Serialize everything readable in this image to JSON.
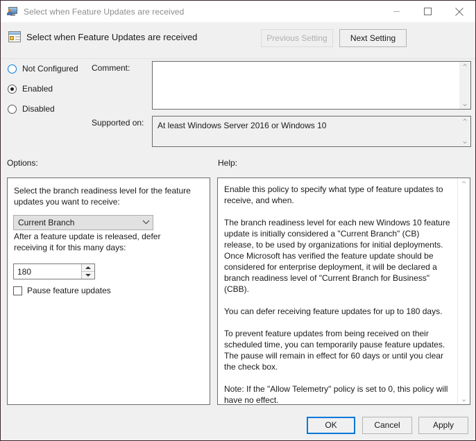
{
  "window": {
    "title": "Select when Feature Updates are received",
    "icon": "policy-monitor-icon",
    "minimize_label": "—",
    "maximize_label": "☐",
    "close_label": "✕"
  },
  "header": {
    "icon": "policy-setting-icon",
    "title": "Select when Feature Updates are received",
    "previous_setting_label": "Previous Setting",
    "next_setting_label": "Next Setting"
  },
  "state": {
    "radios": [
      {
        "label": "Not Configured",
        "selected": false
      },
      {
        "label": "Enabled",
        "selected": true
      },
      {
        "label": "Disabled",
        "selected": false
      }
    ],
    "comment_label": "Comment:",
    "comment_value": "",
    "supported_on_label": "Supported on:",
    "supported_on_value": "At least Windows Server 2016 or Windows 10"
  },
  "options": {
    "section_label": "Options:",
    "branch_prompt": "Select the branch readiness level for the feature updates you want to receive:",
    "branch_selected": "Current Branch",
    "defer_prompt": "After a feature update is released, defer receiving it for this many days:",
    "defer_days": "180",
    "pause_label": "Pause feature updates",
    "pause_checked": false
  },
  "help": {
    "section_label": "Help:",
    "paragraphs": [
      "Enable this policy to specify what type of feature updates to receive, and when.",
      "The branch readiness level for each new Windows 10 feature update is initially considered a \"Current Branch\" (CB) release, to be used by organizations for initial deployments. Once Microsoft has verified the feature update should be considered for enterprise deployment, it will be declared a branch readiness level of \"Current Branch for Business\" (CBB).",
      "You can defer receiving feature updates for up to 180 days.",
      "To prevent feature updates from being received on their scheduled time, you can temporarily pause feature updates. The pause will remain in effect for 60 days or until you clear the check box.",
      "Note: If the \"Allow Telemetry\" policy is set to 0, this policy will have no effect."
    ]
  },
  "footer": {
    "ok_label": "OK",
    "cancel_label": "Cancel",
    "apply_label": "Apply"
  },
  "scroll": {
    "up_glyph": "⌃",
    "down_glyph": "⌄"
  },
  "colors": {
    "accent": "#0078d7",
    "window_bg": "#f0f0f0",
    "field_bg": "#ffffff"
  }
}
